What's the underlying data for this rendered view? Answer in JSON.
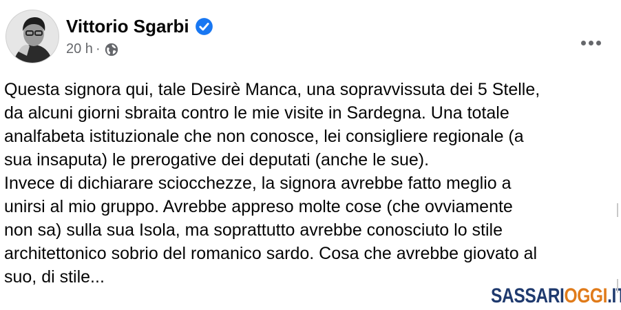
{
  "author": {
    "name": "Vittorio Sgarbi",
    "verified_icon": "verified-check-icon",
    "badge_color": "#1877f2"
  },
  "meta": {
    "time": "20 h",
    "separator": "·",
    "audience_icon": "globe-icon"
  },
  "menu_icon": "more-options-icon",
  "post_lines": [
    "Questa signora qui, tale Desirè Manca, una sopravvissuta dei 5 Stelle,",
    "da alcuni giorni sbraita contro le mie visite in Sardegna. Una totale",
    "analfabeta istituzionale che non conosce, lei  consigliere regionale (a",
    "sua insaputa) le prerogative dei deputati (anche le sue).",
    "Invece di dichiarare sciocchezze,  la signora avrebbe fatto meglio a",
    "unirsi al mio gruppo. Avrebbe appreso molte cose (che ovviamente",
    "non sa) sulla sua Isola, ma soprattutto  avrebbe conosciuto lo stile",
    "architettonico sobrio del romanico sardo. Cosa che avrebbe giovato al",
    "suo, di stile..."
  ],
  "watermark": {
    "part1": "SASSARI",
    "part2": "OGGI",
    "part3": ".IT",
    "color_primary": "#1f3a6e",
    "color_accent": "#e07b1a"
  }
}
